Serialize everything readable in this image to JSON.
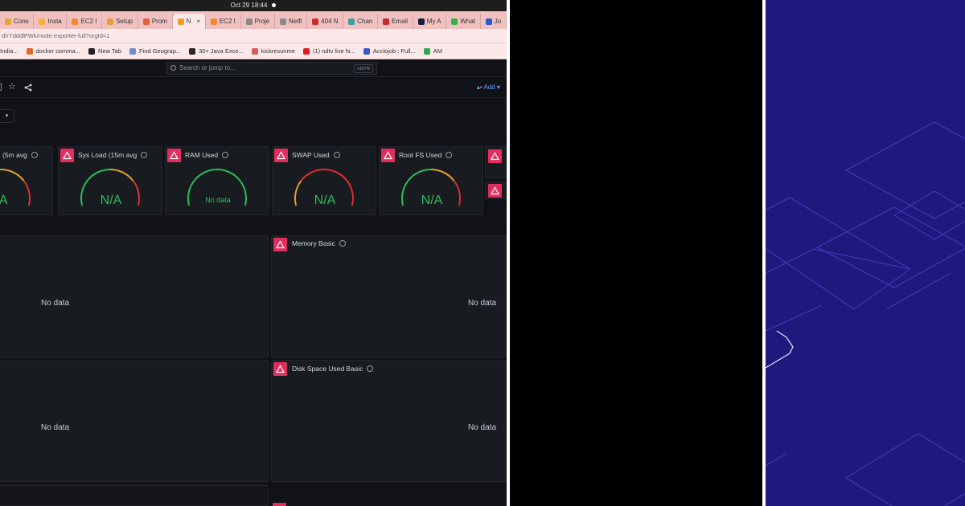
{
  "os": {
    "datetime": "Oct 29  18:44"
  },
  "tabs": [
    {
      "label": "Cons",
      "color": "#e8a23a"
    },
    {
      "label": "Insta",
      "color": "#f4b13a"
    },
    {
      "label": "EC2 I",
      "color": "#f28a2b"
    },
    {
      "label": "Setup",
      "color": "#e89a3c"
    },
    {
      "label": "Prom",
      "color": "#e25f3a"
    },
    {
      "label": "N",
      "color": "#f29a2b",
      "active": true
    },
    {
      "label": "EC2 I",
      "color": "#f28a2b"
    },
    {
      "label": "Proje",
      "color": "#8a8a8a"
    },
    {
      "label": "Netfl",
      "color": "#8a8a8a"
    },
    {
      "label": "404 N",
      "color": "#c92a2a"
    },
    {
      "label": "Chan",
      "color": "#3aa0a0"
    },
    {
      "label": "Email",
      "color": "#c92a2a"
    },
    {
      "label": "My A",
      "color": "#1a1a3a"
    },
    {
      "label": "What",
      "color": "#2fb34a"
    },
    {
      "label": "Jo",
      "color": "#2a5ac9"
    }
  ],
  "url": "d/rYdddlPWk/node-exporter-full?orgId=1",
  "bookmarks": [
    {
      "label": "India...",
      "color": "#e8e8e8"
    },
    {
      "label": "docker comma...",
      "color": "#e2672c"
    },
    {
      "label": "New Tab",
      "color": "#222222"
    },
    {
      "label": "Find Geograp...",
      "color": "#6a8fd0"
    },
    {
      "label": "30+ Java Exce...",
      "color": "#2a2a2a"
    },
    {
      "label": "kickresunme",
      "color": "#e05a5a"
    },
    {
      "label": "(1) ndtv live hi...",
      "color": "#e02020"
    },
    {
      "label": "Acciojob : Full...",
      "color": "#3a5ad0"
    },
    {
      "label": "AM",
      "color": "#34a853"
    }
  ],
  "search": {
    "placeholder": "Search or jump to...",
    "shortcut": "ctrl+k"
  },
  "toolbar": {
    "add_label": "Add"
  },
  "gauges": [
    {
      "title": "(5m avg",
      "value": "/A"
    },
    {
      "title": "Sys Load (15m avg",
      "value": "N/A"
    },
    {
      "title": "RAM Used",
      "value": "No data"
    },
    {
      "title": "SWAP Used",
      "value": "N/A"
    },
    {
      "title": "Root FS Used",
      "value": "N/A"
    }
  ],
  "panels": {
    "memory_basic": {
      "title": "Memory Basic",
      "nodata": "No data"
    },
    "disk_basic": {
      "title": "Disk Space Used Basic",
      "nodata": "No data"
    },
    "left_top": {
      "nodata": "No data"
    },
    "left_bottom": {
      "nodata": "No data"
    }
  },
  "colors": {
    "accent": "#e02f5f",
    "ok": "#2dbd58",
    "bg": "#111217",
    "purple": "#21187d"
  }
}
